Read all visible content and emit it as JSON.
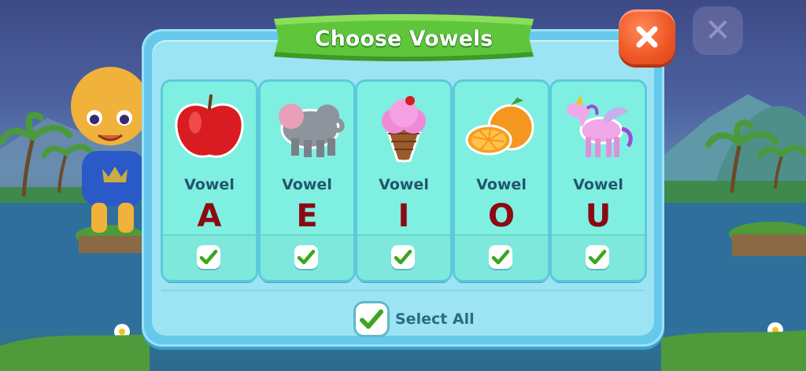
{
  "dialog": {
    "title": "Choose Vowels",
    "close_icon": "close-x-icon"
  },
  "cards": [
    {
      "label": "Vowel",
      "letter": "A",
      "picture": "apple-icon",
      "checked": true
    },
    {
      "label": "Vowel",
      "letter": "E",
      "picture": "elephant-icon",
      "checked": true
    },
    {
      "label": "Vowel",
      "letter": "I",
      "picture": "ice-cream-icon",
      "checked": true
    },
    {
      "label": "Vowel",
      "letter": "O",
      "picture": "orange-icon",
      "checked": true
    },
    {
      "label": "Vowel",
      "letter": "U",
      "picture": "unicorn-icon",
      "checked": true
    }
  ],
  "select_all": {
    "label": "Select All",
    "checked": true
  },
  "colors": {
    "ribbon": "#5fc63c",
    "close_button": "#f05a28",
    "card": "#7fefe2",
    "letter": "#8b0a12",
    "check": "#3da51f"
  }
}
